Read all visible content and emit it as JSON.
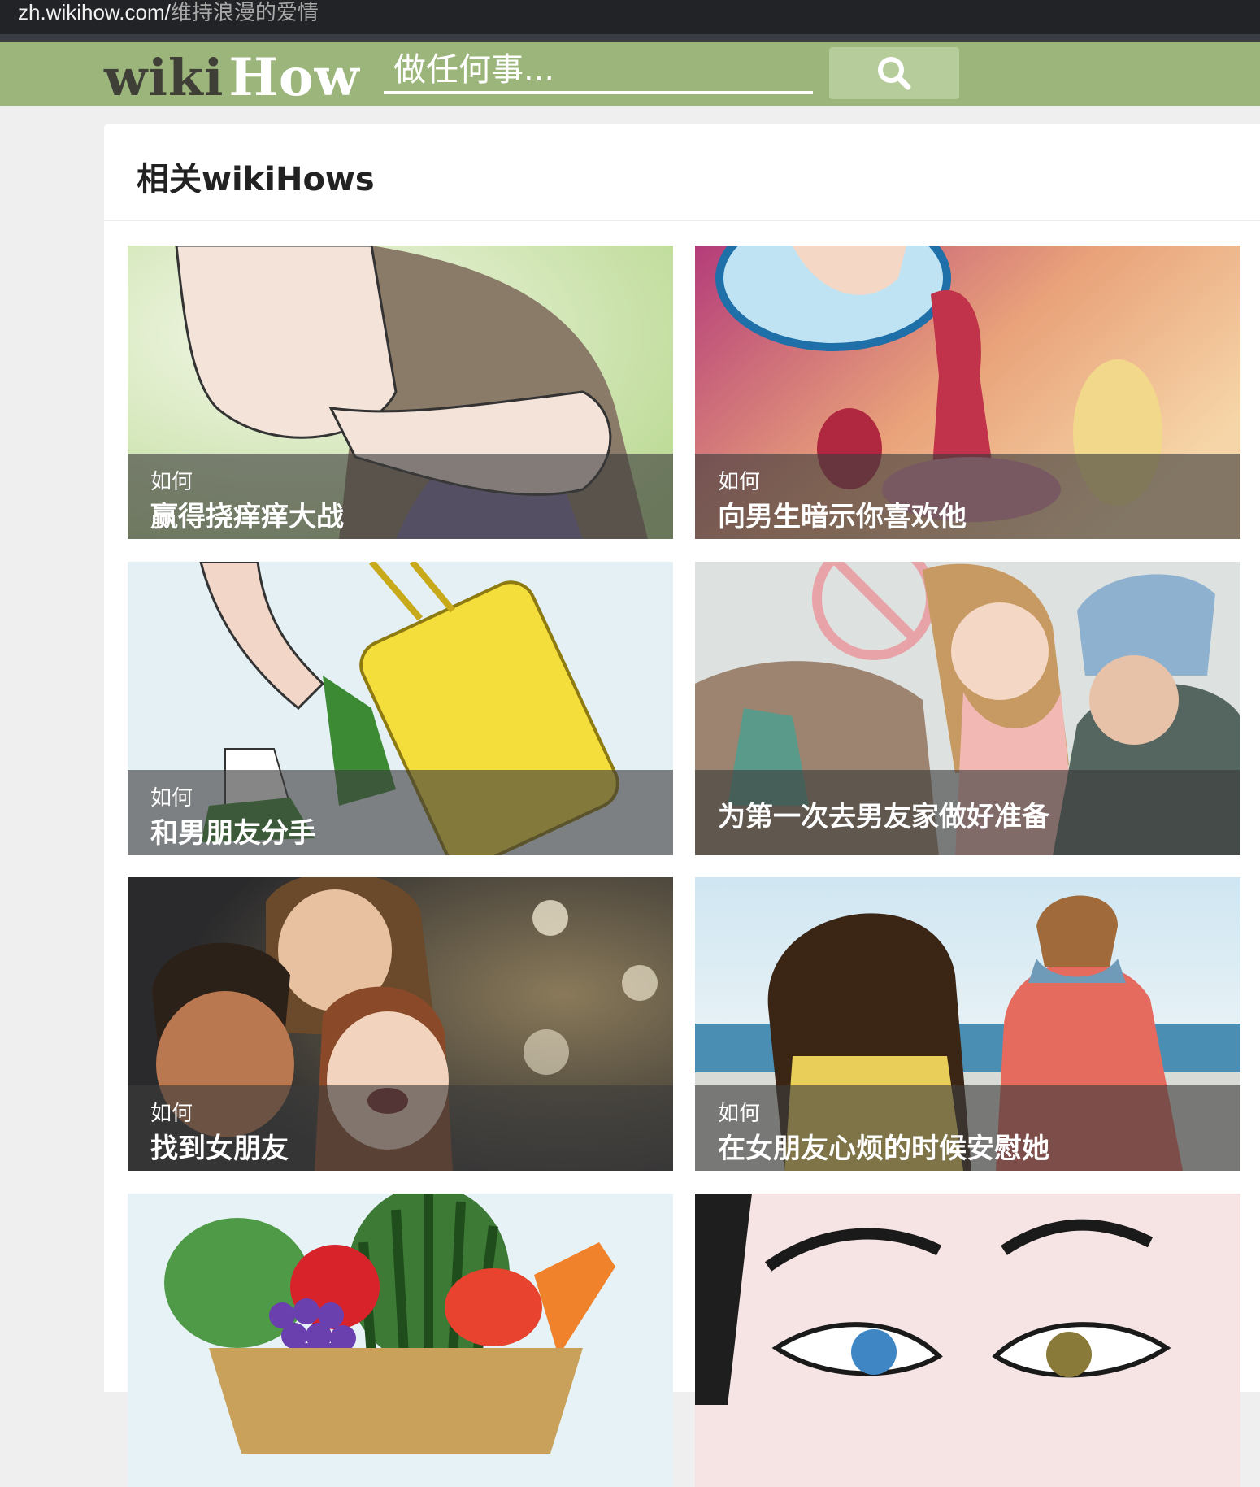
{
  "browser": {
    "url_domain": "zh.wikihow.com/",
    "url_path": "维持浪漫的爱情"
  },
  "header": {
    "logo_wiki": "wiki",
    "logo_how": "How",
    "search_placeholder": "做任何事..."
  },
  "related": {
    "title": "相关wikiHows",
    "items": [
      {
        "prefix": "如何",
        "title": "赢得挠痒痒大战"
      },
      {
        "prefix": "如何",
        "title": "向男生暗示你喜欢他"
      },
      {
        "prefix": "如何",
        "title": "和男朋友分手"
      },
      {
        "prefix": "",
        "title": "为第一次去男友家做好准备"
      },
      {
        "prefix": "如何",
        "title": "找到女朋友"
      },
      {
        "prefix": "如何",
        "title": "在女朋友心烦的时候安慰她"
      }
    ]
  }
}
